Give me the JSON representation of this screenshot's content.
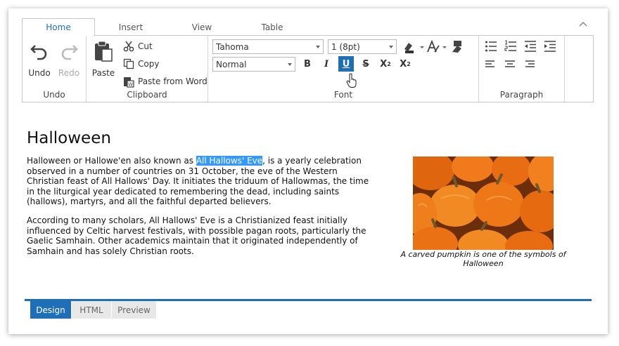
{
  "tabs": [
    {
      "label": "Home",
      "active": true
    },
    {
      "label": "Insert",
      "active": false
    },
    {
      "label": "View",
      "active": false
    },
    {
      "label": "Table",
      "active": false
    }
  ],
  "collapse_icon": "chevron-up-icon",
  "groups": {
    "undo": {
      "label": "Undo",
      "undo_label": "Undo",
      "redo_label": "Redo"
    },
    "clipboard": {
      "label": "Clipboard",
      "paste_label": "Paste",
      "cut_label": "Cut",
      "copy_label": "Copy",
      "paste_word_label": "Paste from Word"
    },
    "font": {
      "label": "Font",
      "font_family": "Tahoma",
      "font_size": "1 (8pt)",
      "paragraph_style": "Normal",
      "bold": "B",
      "italic": "I",
      "underline": "U",
      "strike": "S",
      "superscript": "X",
      "superscript_mark": "2",
      "subscript": "X",
      "subscript_mark": "2",
      "active_button": "underline"
    },
    "paragraph": {
      "label": "Paragraph"
    }
  },
  "document": {
    "title": "Halloween",
    "para1_before": "Halloween or Hallowe'en also known as ",
    "para1_selected": "All Hallows' Eve",
    "para1_after": ", is a yearly celebration observed in a number of countries on 31 October, the eve of the Western Christian feast of All Hallows' Day. It initiates the triduum of Hallowmas, the time in the liturgical year dedicated to remembering the dead, including saints (hallows), martyrs, and all the faithful departed believers.",
    "para2": "According to many scholars, All Hallows' Eve is a Christianized feast initially influenced by Celtic harvest festivals, with possible pagan roots, particularly the Gaelic Samhain. Other academics maintain that it originated independently of Samhain and has solely Christian roots.",
    "image_caption": "A carved pumpkin is one of the symbols of Halloween"
  },
  "bottom_tabs": [
    {
      "label": "Design",
      "active": true
    },
    {
      "label": "HTML",
      "active": false
    },
    {
      "label": "Preview",
      "active": false
    }
  ],
  "colors": {
    "accent": "#1e6fb8",
    "selection": "#3399ff"
  }
}
